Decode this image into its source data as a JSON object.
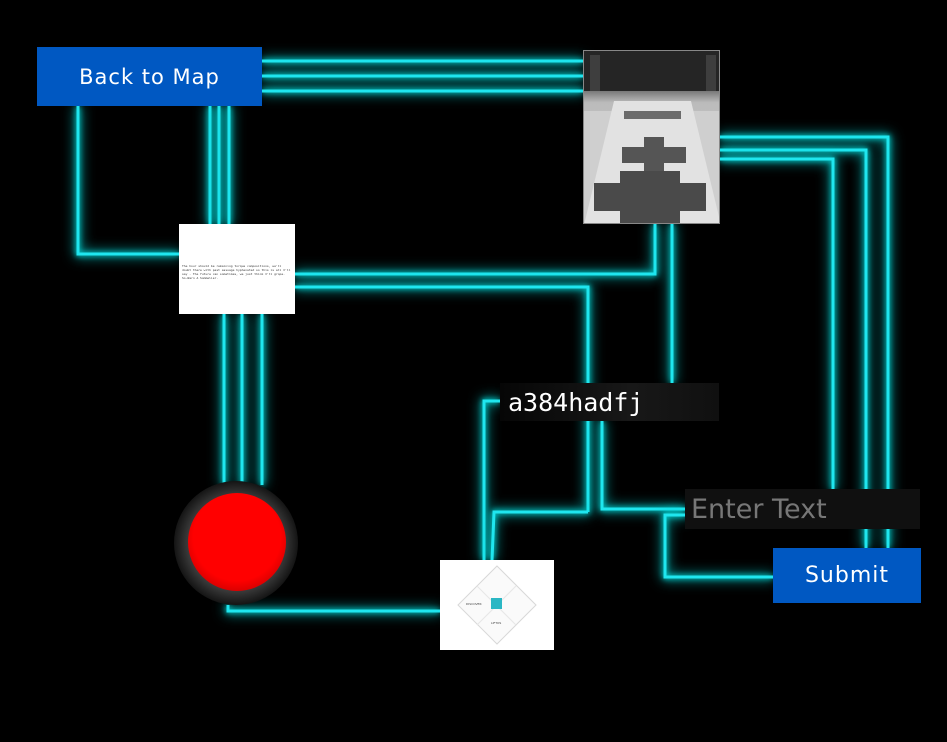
{
  "buttons": {
    "back_to_map": "Back to Map",
    "submit": "Submit"
  },
  "code_display": "a384hadfj",
  "text_input": {
    "placeholder": "Enter Text",
    "value": ""
  },
  "note_text": "The hour should be remaining torque compositions, we'll doubt there with past assuage hyphenated so this is all I'll say - The future can sometimes, we just think I'll grope. So-Warn A Sommelier.",
  "diagram": {
    "left_label": "DISCOVER",
    "bottom_label": "LIFTOS"
  },
  "colors": {
    "wire": "#1fe6ef",
    "button_bg": "#0058c2",
    "red_button": "#ff0000"
  },
  "icons": {
    "red_button": "big-red-push-button",
    "photo": "tiled-marble-floor-photo"
  }
}
